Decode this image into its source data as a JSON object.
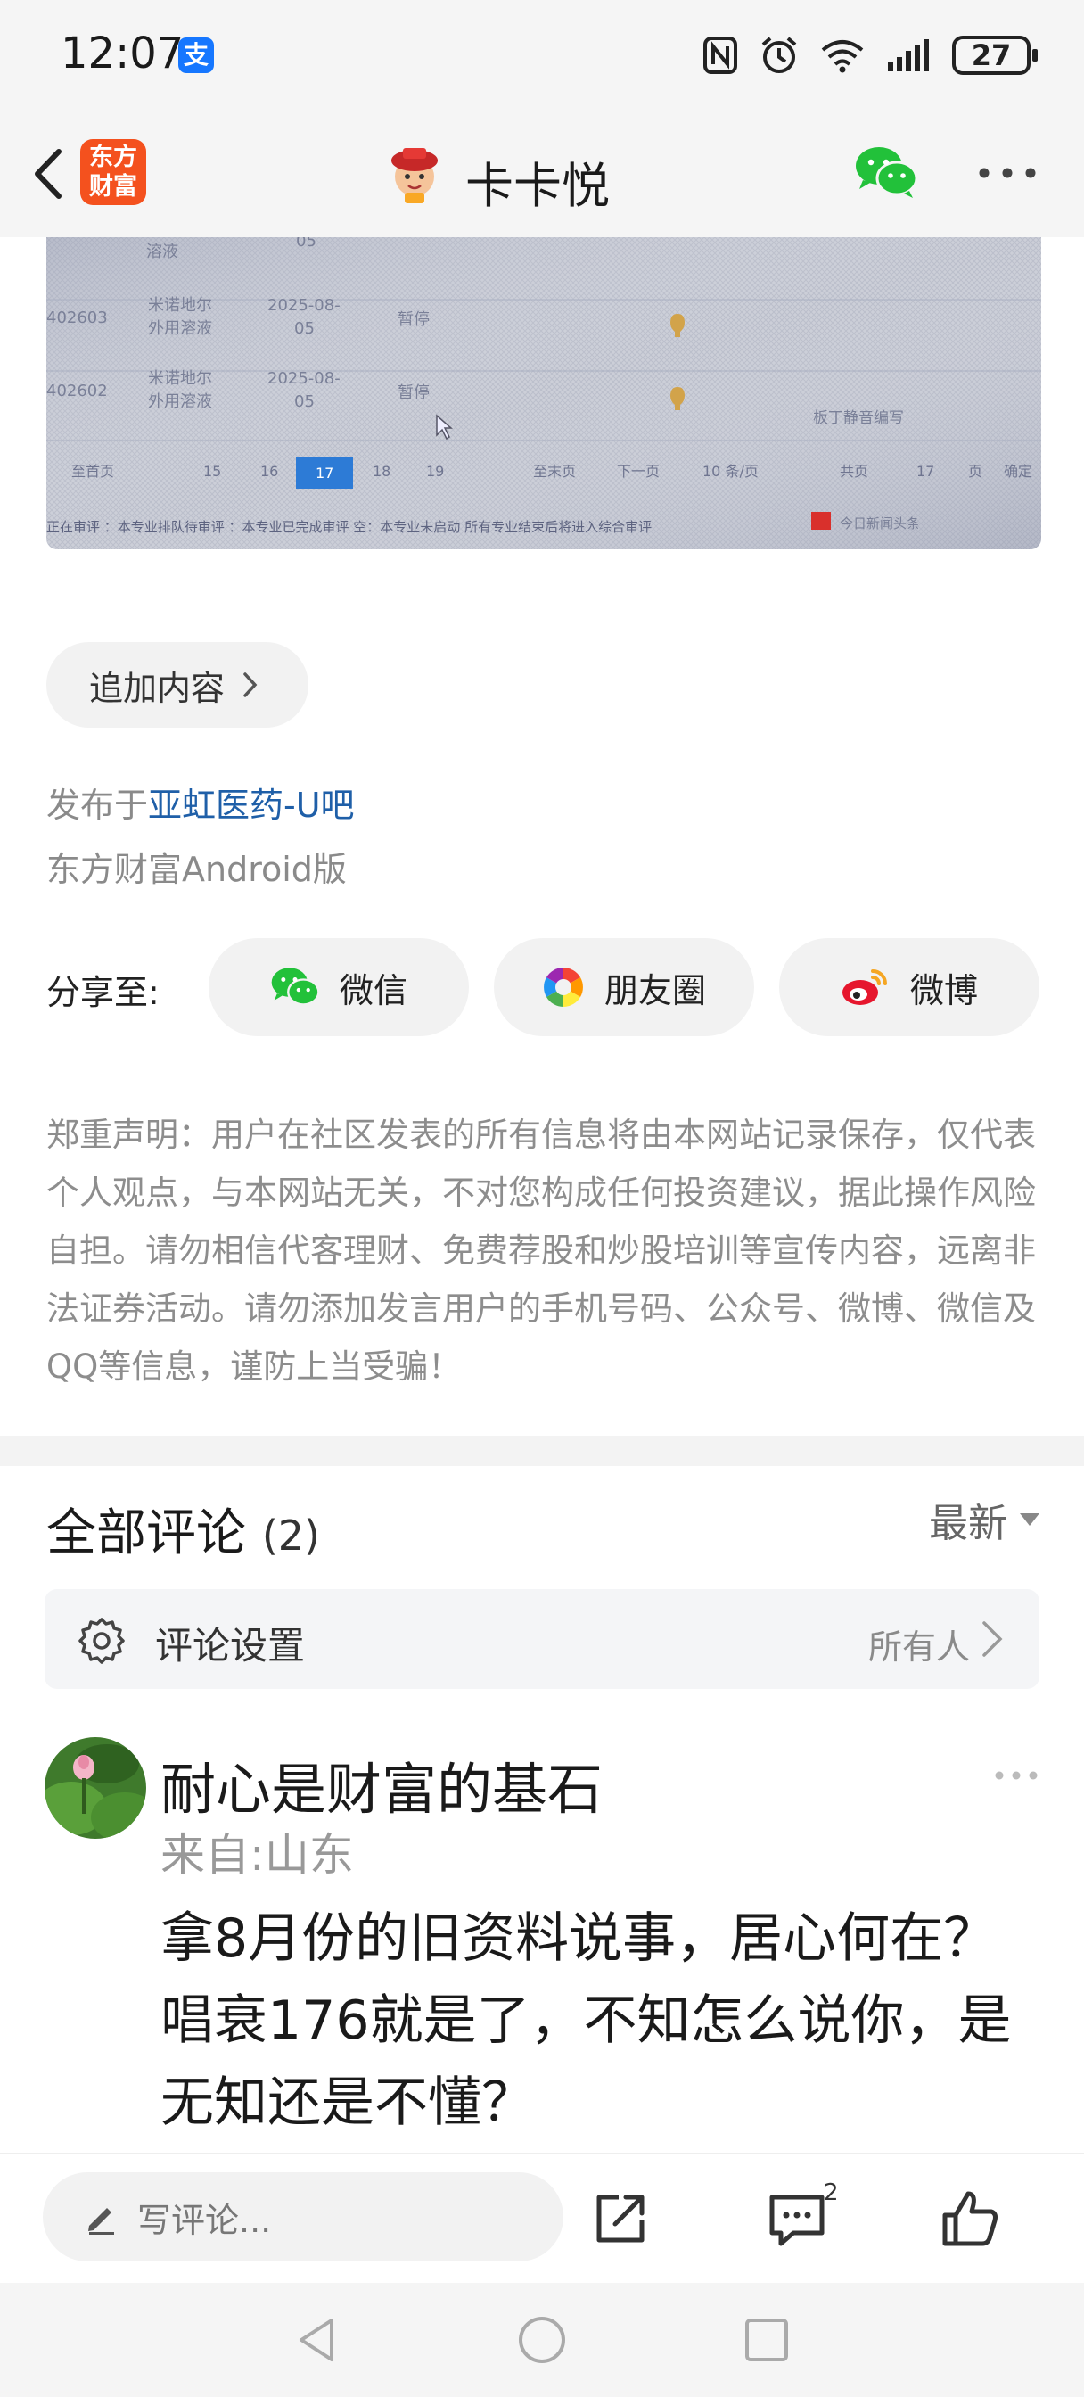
{
  "status_bar": {
    "time": "12:07",
    "alipay_glyph": "支",
    "battery": "27"
  },
  "header": {
    "brand_logo_text": "东方财富",
    "author": "卡卡悦"
  },
  "post": {
    "append_button": "追加内容",
    "published_prefix": "发布于",
    "published_bar": "亚虹医药-U吧",
    "client": "东方财富Android版",
    "image_texts": {
      "row_a_id": "402603",
      "row_a_name_1": "米诺地尔",
      "row_a_name_2": "外用溶液",
      "row_a_date_1": "2025-08-",
      "row_a_date_2": "05",
      "row_a_status": "暂停",
      "row_b_id": "402602",
      "row_b_name_1": "米诺地尔",
      "row_b_name_2": "外用溶液",
      "row_b_date_1": "2025-08-",
      "row_b_date_2": "05",
      "row_b_status": "暂停",
      "top_fragment": "溶液",
      "top_date": "05",
      "pager_first": "至首页",
      "page_15": "15",
      "page_16": "16",
      "page_17": "17",
      "page_18": "18",
      "page_19": "19",
      "pager_last": "至末页",
      "pager_next": "下一页",
      "page_size": "10 条/页",
      "page_total": "共页",
      "jump_page": "17",
      "page_unit": "页",
      "confirm": "确定",
      "legend": "正在审评   ：本专业排队待审评   ：本专业已完成审评   空：本专业未启动   所有专业结束后将进入综合审评",
      "watermark": "今日新闻头条",
      "toast": "板丁静音编写"
    }
  },
  "share": {
    "label": "分享至:",
    "wechat": "微信",
    "moments": "朋友圈",
    "weibo": "微博"
  },
  "disclaimer": "郑重声明：用户在社区发表的所有信息将由本网站记录保存，仅代表个人观点，与本网站无关，不对您构成任何投资建议，据此操作风险自担。请勿相信代客理财、免费荐股和炒股培训等宣传内容，远离非法证券活动。请勿添加发言用户的手机号码、公众号、微博、微信及QQ等信息，谨防上当受骗！",
  "comments": {
    "title": "全部评论",
    "count": "(2)",
    "sort": "最新",
    "settings_label": "评论设置",
    "settings_value": "所有人",
    "items": [
      {
        "user": "耐心是财富的基石",
        "location": "来自:山东",
        "body": "拿8月份的旧资料说事，居心何在？唱衰176就是了，不知怎么说你，是无知还是不懂？"
      }
    ]
  },
  "action_bar": {
    "write_placeholder": "写评论...",
    "comment_badge": "2"
  },
  "colors": {
    "link": "#1f5fa8",
    "brand_orange": "#f4511e",
    "wechat_green": "#22c13a",
    "weibo_red": "#e6162d"
  },
  "icons": [
    "back-icon",
    "wechat-icon",
    "more-icon",
    "moments-icon",
    "weibo-icon",
    "gear-icon",
    "chevron-right-icon",
    "pen-icon",
    "share-icon",
    "comment-icon",
    "like-icon"
  ]
}
